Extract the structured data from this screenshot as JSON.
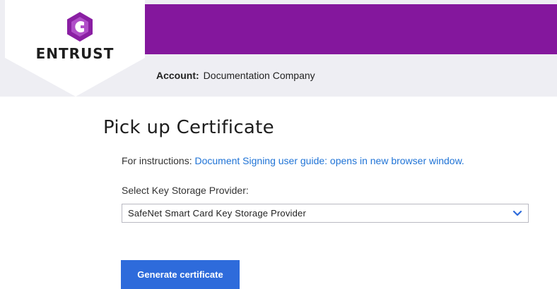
{
  "brand": {
    "name": "ENTRUST",
    "logo_icon": "entrust-hexagon-logo",
    "accent_color": "#84179d"
  },
  "account": {
    "label": "Account:",
    "value": "Documentation Company"
  },
  "main": {
    "title": "Pick up Certificate",
    "instructions_prefix": "For instructions:",
    "instructions_link": "Document Signing user guide: opens in new browser window.",
    "select_label": "Select Key Storage Provider:",
    "select_value": "SafeNet Smart Card Key Storage Provider",
    "select_icon": "chevron-down-icon",
    "generate_button_label": "Generate certificate",
    "button_color": "#2e6bdb",
    "link_color": "#1f73d6"
  }
}
